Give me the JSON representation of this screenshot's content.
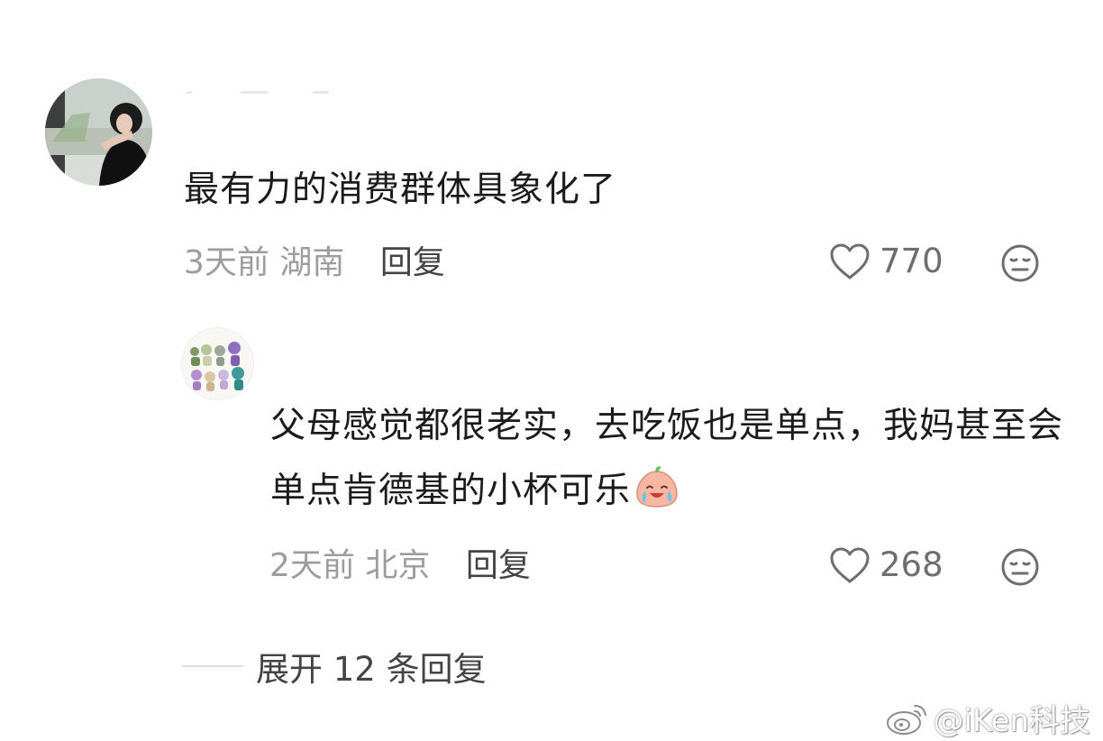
{
  "comments": {
    "main": {
      "text": "最有力的消费群体具象化了",
      "time": "3天前",
      "location": "湖南",
      "reply_label": "回复",
      "likes": "770"
    },
    "reply": {
      "text": "父母感觉都很老实，去吃饭也是单点，我妈甚至会单点肯德基的小杯可乐",
      "time": "2天前",
      "location": "北京",
      "reply_label": "回复",
      "likes": "268"
    }
  },
  "expand_label": "展开 12 条回复",
  "watermark": "@iKen科技",
  "icons": {
    "like": "heart-outline-icon",
    "dislike": "meh-face-icon",
    "emoji": "crying-laughing-peach-emoji",
    "watermark": "weibo-logo-icon"
  },
  "colors": {
    "text_primary": "#1b1b1b",
    "text_secondary": "#9d9d9d",
    "text_action": "#444444",
    "icon": "#6e6e6e"
  }
}
